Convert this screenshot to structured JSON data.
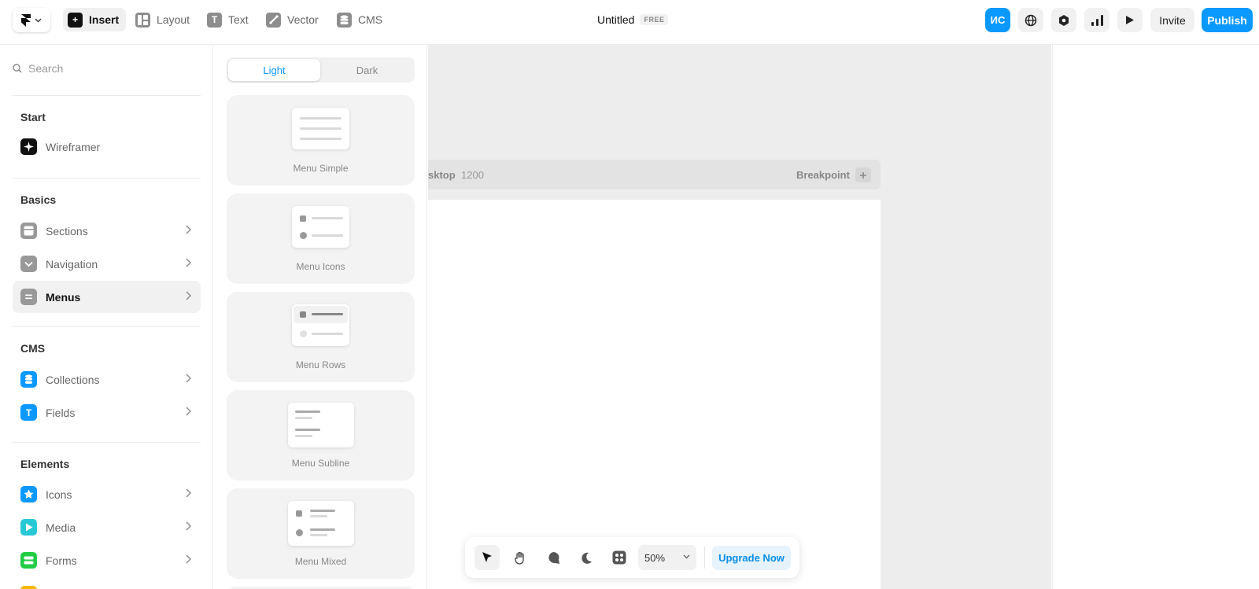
{
  "toolbar": {
    "tools": [
      {
        "label": "Insert",
        "icon": "plus-icon"
      },
      {
        "label": "Layout",
        "icon": "layout-icon"
      },
      {
        "label": "Text",
        "icon": "text-icon"
      },
      {
        "label": "Vector",
        "icon": "vector-icon"
      },
      {
        "label": "CMS",
        "icon": "database-icon"
      }
    ],
    "document_title": "Untitled",
    "plan_badge": "FREE",
    "avatar_initials": "ИС",
    "invite_label": "Invite",
    "publish_label": "Publish"
  },
  "sidebar": {
    "search_placeholder": "Search",
    "sections": [
      {
        "title": "Start",
        "items": [
          {
            "label": "Wireframer"
          }
        ]
      },
      {
        "title": "Basics",
        "items": [
          {
            "label": "Sections"
          },
          {
            "label": "Navigation"
          },
          {
            "label": "Menus",
            "selected": true
          }
        ]
      },
      {
        "title": "CMS",
        "items": [
          {
            "label": "Collections"
          },
          {
            "label": "Fields"
          }
        ]
      },
      {
        "title": "Elements",
        "items": [
          {
            "label": "Icons"
          },
          {
            "label": "Media"
          },
          {
            "label": "Forms"
          }
        ]
      }
    ]
  },
  "panel": {
    "theme_options": [
      "Light",
      "Dark"
    ],
    "selected_theme": "Light",
    "cards": [
      {
        "label": "Menu Simple"
      },
      {
        "label": "Menu Icons"
      },
      {
        "label": "Menu Rows"
      },
      {
        "label": "Menu Subline"
      },
      {
        "label": "Menu Mixed"
      }
    ]
  },
  "canvas": {
    "breakpoint_name": "sktop",
    "breakpoint_width": "1200",
    "add_breakpoint_label": "Breakpoint"
  },
  "bottom_toolbar": {
    "zoom": "50%",
    "upgrade_label": "Upgrade Now"
  },
  "colors": {
    "accent": "#0b99ff",
    "canvas_bg": "#ededed"
  }
}
